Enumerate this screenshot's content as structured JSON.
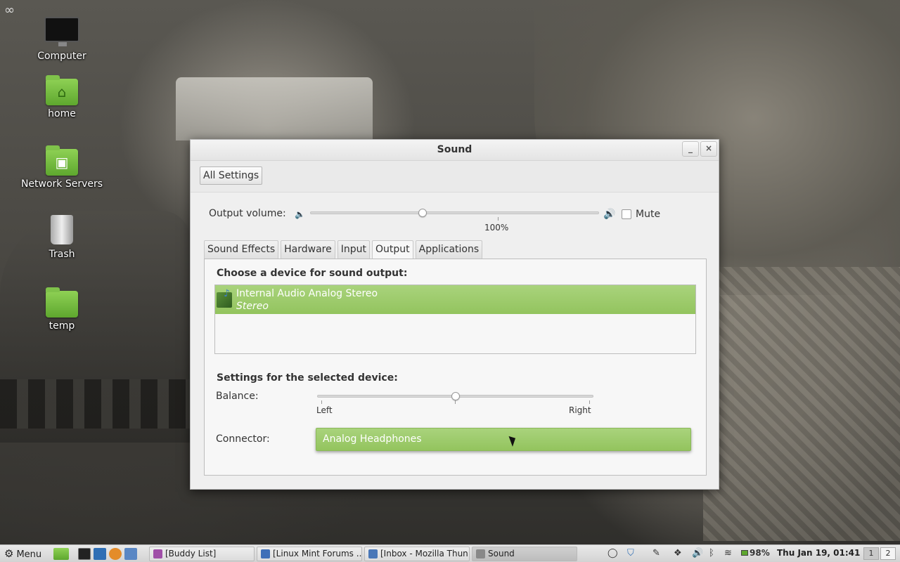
{
  "desktop": {
    "top_left_glyph": "∞",
    "icons": [
      {
        "label": "Computer"
      },
      {
        "label": "home"
      },
      {
        "label": "Network Servers"
      },
      {
        "label": "Trash"
      },
      {
        "label": "temp"
      }
    ]
  },
  "window": {
    "title": "Sound",
    "minimize_glyph": "_",
    "close_glyph": "×",
    "all_settings_label": "All Settings",
    "output_volume_label": "Output volume:",
    "output_volume_value": "100%",
    "output_volume_fraction": 0.39,
    "mute_label": "Mute",
    "mute_checked": false,
    "tabs": [
      {
        "label": "Sound Effects"
      },
      {
        "label": "Hardware"
      },
      {
        "label": "Input"
      },
      {
        "label": "Output",
        "active": true
      },
      {
        "label": "Applications"
      }
    ],
    "choose_heading": "Choose a device for sound output:",
    "devices": [
      {
        "name": "Internal Audio Analog Stereo",
        "subtitle": "Stereo",
        "selected": true
      }
    ],
    "settings_heading": "Settings for the selected device:",
    "balance_label": "Balance:",
    "balance_left": "Left",
    "balance_right": "Right",
    "balance_fraction": 0.5,
    "connector_label": "Connector:",
    "connector_value": "Analog Headphones",
    "accent_color": "#9bc969"
  },
  "taskbar": {
    "menu_label": "Menu",
    "tasks": [
      {
        "label": "[Buddy List]"
      },
      {
        "label": "[Linux Mint Forums ..."
      },
      {
        "label": "[Inbox - Mozilla Thun..."
      },
      {
        "label": "Sound",
        "active": true
      }
    ],
    "battery": "98%",
    "clock": "Thu Jan 19, 01:41",
    "workspaces": [
      "1",
      "2"
    ]
  }
}
